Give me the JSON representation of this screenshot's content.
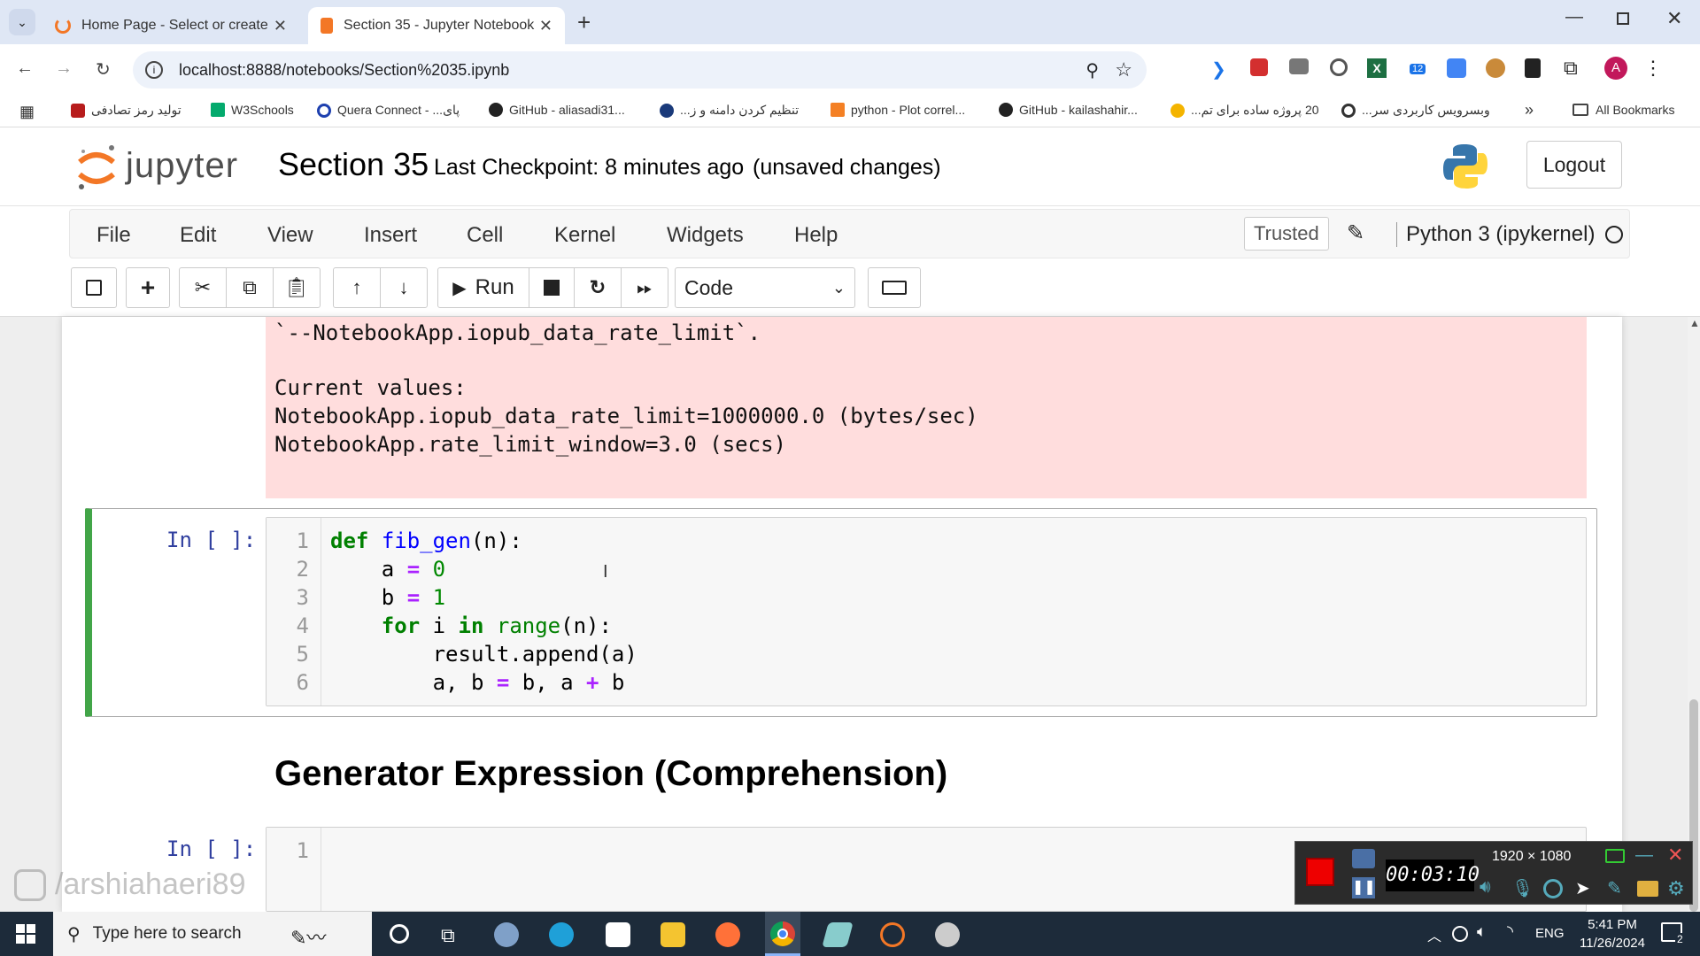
{
  "browser": {
    "tabs": [
      {
        "title": "Home Page - Select or create a",
        "active": false
      },
      {
        "title": "Section 35 - Jupyter Notebook",
        "active": true
      }
    ],
    "url": "localhost:8888/notebooks/Section%2035.ipynb",
    "bookmarks": [
      "تولید رمز تصادفی",
      "W3Schools",
      "Quera Connect - ...پای",
      "GitHub - aliasadi31...",
      "تنظیم کردن دامنه و ز...",
      "python - Plot correl...",
      "GitHub - kailashahir...",
      "20 پروژه ساده برای تم...",
      "وبسرویس کاربردی سر...",
      "All Bookmarks"
    ],
    "profile_initial": "A",
    "extension_badge": "12"
  },
  "jupyter": {
    "logo_text": "jupyter",
    "notebook_name": "Section 35",
    "checkpoint": "Last Checkpoint: 8 minutes ago",
    "unsaved": "(unsaved changes)",
    "logout": "Logout",
    "menus": [
      "File",
      "Edit",
      "View",
      "Insert",
      "Cell",
      "Kernel",
      "Widgets",
      "Help"
    ],
    "trusted": "Trusted",
    "kernel": "Python 3 (ipykernel)",
    "run_label": "Run",
    "cell_type": "Code"
  },
  "output_error": {
    "lines": [
      "`--NotebookApp.iopub_data_rate_limit`.",
      "",
      "Current values:",
      "NotebookApp.iopub_data_rate_limit=1000000.0 (bytes/sec)",
      "NotebookApp.rate_limit_window=3.0 (secs)"
    ]
  },
  "cell1": {
    "prompt": "In [ ]:",
    "line_numbers": [
      "1",
      "2",
      "3",
      "4",
      "5",
      "6"
    ],
    "code": [
      "def fib_gen(n):",
      "    a = 0",
      "    b = 1",
      "    for i in range(n):",
      "        result.append(a)",
      "        a, b = b, a + b"
    ]
  },
  "heading": "Generator Expression (Comprehension)",
  "cell2": {
    "prompt": "In [ ]:",
    "line_number": "1"
  },
  "watermark": "/arshiahaeri89",
  "recorder": {
    "resolution": "1920 × 1080",
    "timer": "00:03:10"
  },
  "taskbar": {
    "search_placeholder": "Type here to search",
    "lang": "ENG",
    "time": "5:41 PM",
    "date": "11/26/2024",
    "notifications": "2"
  }
}
